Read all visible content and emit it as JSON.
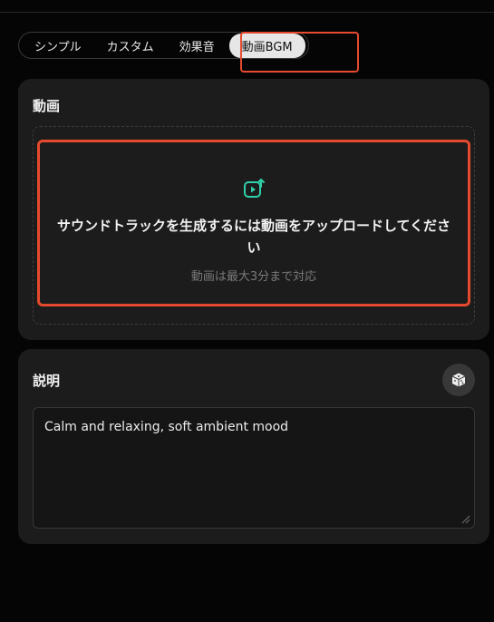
{
  "tabs": [
    {
      "label": "シンプル",
      "active": false
    },
    {
      "label": "カスタム",
      "active": false
    },
    {
      "label": "効果音",
      "active": false
    },
    {
      "label": "動画BGM",
      "active": true
    }
  ],
  "video_card": {
    "title": "動画",
    "upload_icon": "video-upload-icon",
    "prompt": "サウンドトラックを生成するには動画をアップロードしてください",
    "note": "動画は最大3分まで対応"
  },
  "description_card": {
    "title": "説明",
    "random_icon": "dice-icon",
    "value": "Calm and relaxing, soft ambient mood"
  },
  "colors": {
    "accent_green": "#2fd0a8",
    "highlight_red": "#e64a2e"
  }
}
